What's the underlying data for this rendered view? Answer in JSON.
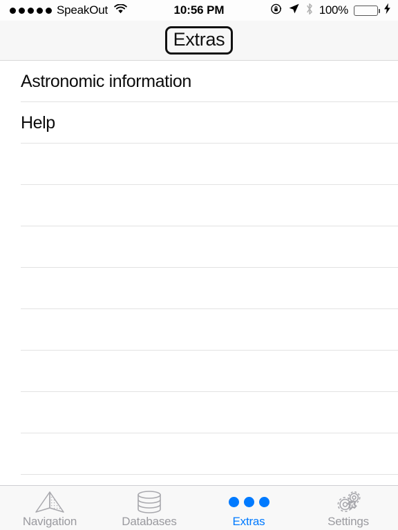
{
  "status_bar": {
    "signal_dots_filled": 5,
    "signal_dots_total": 5,
    "carrier": "SpeakOut",
    "wifi_icon": "wifi-icon",
    "time": "10:56 PM",
    "rotation_lock_icon": "rotation-lock-icon",
    "location_icon": "location-arrow-icon",
    "bluetooth_icon": "bluetooth-icon",
    "battery_percent": "100%",
    "battery_level": 100,
    "battery_color": "#4CD964",
    "charging_icon": "lightning-bolt-icon"
  },
  "nav_bar": {
    "title": "Extras"
  },
  "list": {
    "items": [
      {
        "label": "Astronomic information"
      },
      {
        "label": "Help"
      },
      {
        "label": ""
      },
      {
        "label": ""
      },
      {
        "label": ""
      },
      {
        "label": ""
      },
      {
        "label": ""
      },
      {
        "label": ""
      },
      {
        "label": ""
      },
      {
        "label": ""
      }
    ]
  },
  "tab_bar": {
    "active_color": "#007AFF",
    "inactive_color": "#9A9A9F",
    "tabs": [
      {
        "label": "Navigation",
        "icon": "navigation-arrow-icon",
        "active": false
      },
      {
        "label": "Databases",
        "icon": "database-cylinder-icon",
        "active": false
      },
      {
        "label": "Extras",
        "icon": "three-dots-icon",
        "active": true
      },
      {
        "label": "Settings",
        "icon": "gears-icon",
        "active": false
      }
    ]
  }
}
